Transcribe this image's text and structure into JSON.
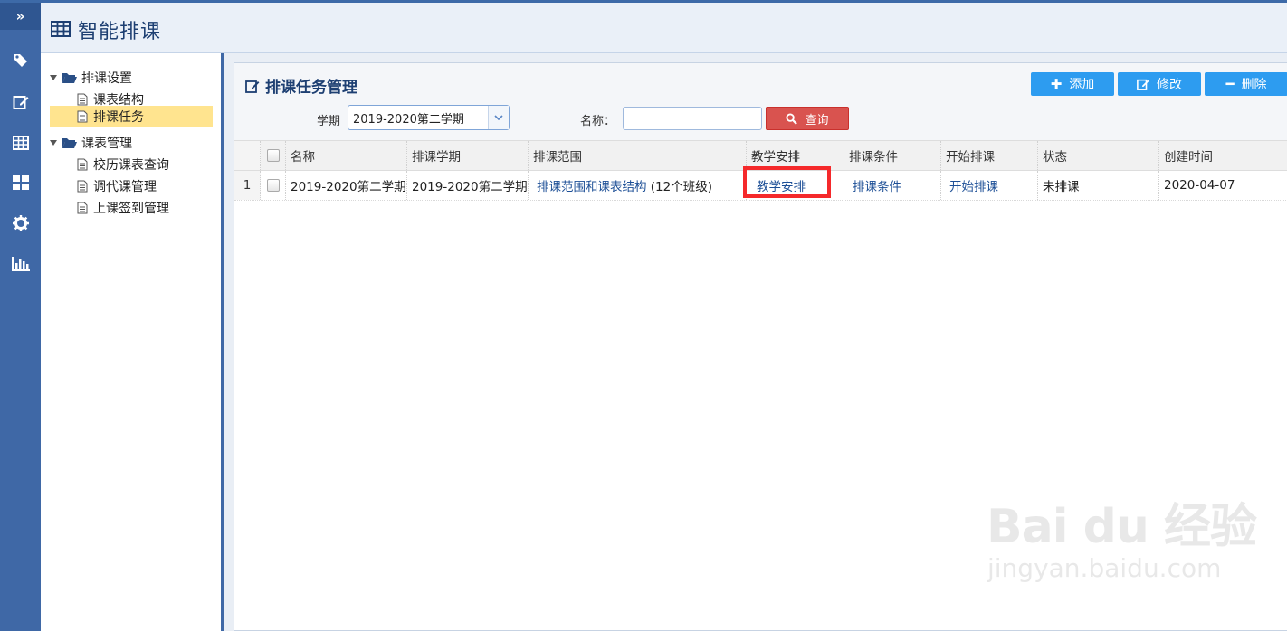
{
  "app": {
    "title": "智能排课"
  },
  "rail": {
    "items": [
      "expand-icon",
      "tag-icon",
      "edit-icon",
      "table-icon",
      "grid-icon",
      "gear-icon",
      "bar-chart-icon"
    ],
    "toggle_label": "»"
  },
  "tree": {
    "groups": [
      {
        "label": "排课设置",
        "children": [
          "课表结构",
          "排课任务"
        ]
      },
      {
        "label": "课表管理",
        "children": [
          "校历课表查询",
          "调代课管理",
          "上课签到管理"
        ]
      }
    ],
    "selected": "排课任务"
  },
  "panel": {
    "title": "排课任务管理",
    "buttons": {
      "add": "添加",
      "edit": "修改",
      "delete": "删除"
    },
    "filter": {
      "term_label": "学期",
      "term_value": "2019-2020第二学期",
      "name_label": "名称：",
      "name_value": "",
      "search_label": "查询"
    }
  },
  "grid": {
    "columns": [
      "名称",
      "排课学期",
      "排课范围",
      "教学安排",
      "排课条件",
      "开始排课",
      "状态",
      "创建时间"
    ],
    "rows": [
      {
        "index": "1",
        "name": "2019-2020第二学期",
        "term": "2019-2020第二学期",
        "scope_link": "排课范围和课表结构",
        "scope_suffix": " (12个班级)",
        "arrange": "教学安排",
        "conditions": "排课条件",
        "start": "开始排课",
        "status": "未排课",
        "created": "2020-04-07"
      }
    ]
  },
  "colors": {
    "rail": "#3f68a6",
    "accent_button": "#2d9cf0",
    "search_button": "#d9534f",
    "selected_node": "#ffe48f",
    "highlight_box": "#f5292b"
  },
  "watermark": {
    "brand": "Bai du 经验",
    "url": "jingyan.baidu.com"
  }
}
